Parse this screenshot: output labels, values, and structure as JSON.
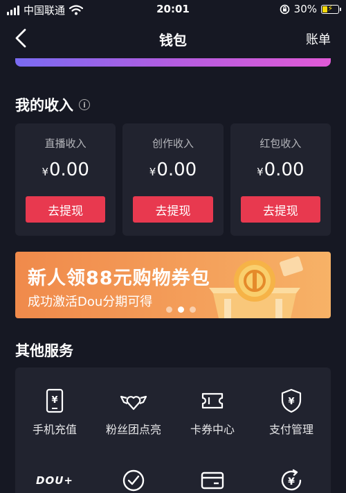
{
  "status_bar": {
    "carrier": "中国联通",
    "time": "20:01",
    "battery": "30%"
  },
  "nav": {
    "title": "钱包",
    "right_label": "账单"
  },
  "income": {
    "title": "我的收入",
    "cards": [
      {
        "label": "直播收入",
        "currency": "¥",
        "amount": "0.00",
        "button": "去提现"
      },
      {
        "label": "创作收入",
        "currency": "¥",
        "amount": "0.00",
        "button": "去提现"
      },
      {
        "label": "红包收入",
        "currency": "¥",
        "amount": "0.00",
        "button": "去提现"
      }
    ]
  },
  "banner": {
    "title": "新人领88元购物券包",
    "subtitle": "成功激活Dou分期可得",
    "page_count": 3,
    "active_page": 2
  },
  "services": {
    "title": "其他服务",
    "items": [
      {
        "label": "手机充值",
        "icon": "phone-recharge-icon"
      },
      {
        "label": "粉丝团点亮",
        "icon": "heart-wings-icon"
      },
      {
        "label": "卡券中心",
        "icon": "ticket-icon"
      },
      {
        "label": "支付管理",
        "icon": "shield-yen-icon"
      },
      {
        "label": "DOU+",
        "icon": "dou-plus-logo"
      },
      {
        "label": "",
        "icon": "check-circle-icon"
      },
      {
        "label": "",
        "icon": "card-wallet-icon"
      },
      {
        "label": "",
        "icon": "yen-refresh-icon"
      }
    ]
  },
  "colors": {
    "background": "#161823",
    "card": "#21232f",
    "accent": "#e8394f",
    "banner_orange": "#f08a4b"
  }
}
